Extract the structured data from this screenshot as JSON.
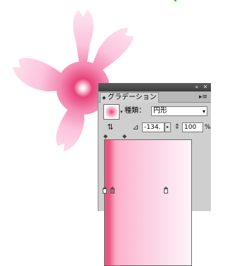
{
  "panel": {
    "tab_title": "グラデーション",
    "tab_arrows": "◆",
    "collapse_glyph": "«",
    "close_glyph": "✕",
    "menu_glyph": "▸≡"
  },
  "gradient": {
    "type_label": "種類：",
    "type_value": "円形",
    "angle_value": "-134.",
    "aspect_ratio_value": "100",
    "aspect_ratio_unit": "%",
    "colors": {
      "start": "#e8567f",
      "mid": "#f9a7c2",
      "end": "#fef3f8",
      "flower_center": "#ffffff",
      "flower_ring": "#e8437a",
      "flower_petal": "#fbc3dc"
    }
  },
  "icons": {
    "swatch_dropdown": "▾",
    "select_arrow": "▾",
    "reverse": "⇅",
    "angle": "⊿",
    "ratio": "⇕",
    "angle_dropdown": "▸",
    "midpoint": "◆"
  }
}
